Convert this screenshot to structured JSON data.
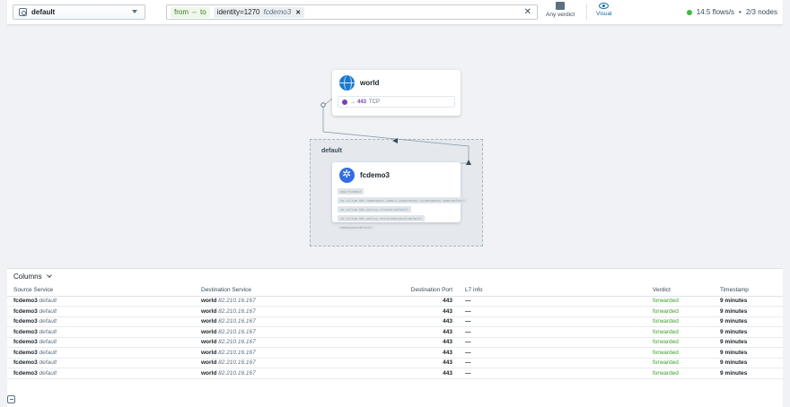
{
  "namespace_select": {
    "value": "default"
  },
  "filter": {
    "direction": {
      "from": "from",
      "to": "to"
    },
    "identity_tag": {
      "label": "identity=1270",
      "sub": "fcdemo3"
    }
  },
  "toolbar": {
    "verdict_label": "Any verdict",
    "visual_label": "Visual"
  },
  "status": {
    "flows": "14.5 flows/s",
    "nodes": "2/3 nodes",
    "color": "#3dbb3d"
  },
  "map": {
    "namespace_label": "default",
    "world_card": {
      "title": "world",
      "port": "443",
      "protocol": "TCP"
    },
    "fc_card": {
      "title": "fcdemo3",
      "labels": [
        "app=fcdemo3",
        "io.cilium.k8s.namespace.labels.kubernetes.io/metadata.name=default",
        "io.cilium.k8s.policy.cluster=default",
        "io.cilium.k8s.policy.serviceaccount=default",
        "namespace=default"
      ]
    }
  },
  "flows_table": {
    "columns_button": "Columns",
    "headers": [
      "Source Service",
      "Destination Service",
      "Destination Port",
      "L7 info",
      "Verdict",
      "Timestamp"
    ],
    "rows": [
      {
        "src": "fcdemo3",
        "src_ns": "default",
        "dst": "world",
        "dst_ip": "82.210.16.167",
        "port": "443",
        "l7": "—",
        "verdict": "forwarded",
        "time": "9 minutes"
      },
      {
        "src": "fcdemo3",
        "src_ns": "default",
        "dst": "world",
        "dst_ip": "82.210.16.167",
        "port": "443",
        "l7": "—",
        "verdict": "forwarded",
        "time": "9 minutes"
      },
      {
        "src": "fcdemo3",
        "src_ns": "default",
        "dst": "world",
        "dst_ip": "82.210.16.167",
        "port": "443",
        "l7": "—",
        "verdict": "forwarded",
        "time": "9 minutes"
      },
      {
        "src": "fcdemo3",
        "src_ns": "default",
        "dst": "world",
        "dst_ip": "82.210.16.167",
        "port": "443",
        "l7": "—",
        "verdict": "forwarded",
        "time": "9 minutes"
      },
      {
        "src": "fcdemo3",
        "src_ns": "default",
        "dst": "world",
        "dst_ip": "82.210.16.167",
        "port": "443",
        "l7": "—",
        "verdict": "forwarded",
        "time": "9 minutes"
      },
      {
        "src": "fcdemo3",
        "src_ns": "default",
        "dst": "world",
        "dst_ip": "82.210.16.167",
        "port": "443",
        "l7": "—",
        "verdict": "forwarded",
        "time": "9 minutes"
      },
      {
        "src": "fcdemo3",
        "src_ns": "default",
        "dst": "world",
        "dst_ip": "82.210.16.167",
        "port": "443",
        "l7": "—",
        "verdict": "forwarded",
        "time": "9 minutes"
      },
      {
        "src": "fcdemo3",
        "src_ns": "default",
        "dst": "world",
        "dst_ip": "82.210.16.167",
        "port": "443",
        "l7": "—",
        "verdict": "forwarded",
        "time": "9 minutes"
      }
    ]
  }
}
